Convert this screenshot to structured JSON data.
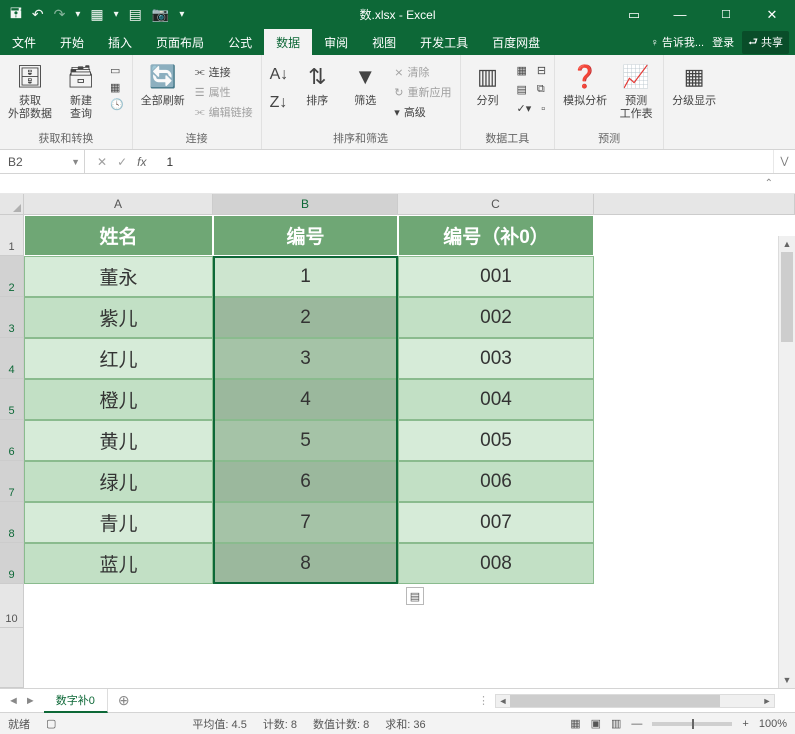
{
  "title": "数.xlsx - Excel",
  "qa": {
    "save": "💾",
    "undo": "↶",
    "redo": "↷",
    "more": "▾"
  },
  "win": {
    "ribbon": "☰",
    "min": "—",
    "max": "☐",
    "close": "✕"
  },
  "menu": {
    "tabs": [
      "文件",
      "开始",
      "插入",
      "页面布局",
      "公式",
      "数据",
      "审阅",
      "视图",
      "开发工具",
      "百度网盘"
    ],
    "active": "数据",
    "tell": "告诉我...",
    "login": "登录",
    "share": "共享"
  },
  "ribbon": {
    "g1": {
      "btn1": "获取\n外部数据",
      "label": "获取和转换"
    },
    "g1b": {
      "btn": "新建\n查询",
      "side": [
        "显示查询",
        "从表格",
        "最近使用的源"
      ]
    },
    "g2": {
      "btn": "全部刷新",
      "side": [
        "连接",
        "属性",
        "编辑链接"
      ],
      "label": "连接"
    },
    "g3": {
      "btns": [
        "排序",
        "筛选"
      ],
      "side": [
        "清除",
        "重新应用",
        "高级"
      ],
      "label": "排序和筛选"
    },
    "g4": {
      "btn": "分列",
      "label": "数据工具"
    },
    "g5": {
      "b1": "模拟分析",
      "b2": "预测\n工作表",
      "label": "预测"
    },
    "g6": {
      "btn": "分级显示",
      "label": ""
    }
  },
  "namebox": "B2",
  "formula": "1",
  "columns": [
    "A",
    "B",
    "C"
  ],
  "headers": [
    "姓名",
    "编号",
    "编号（补0）"
  ],
  "rows": [
    {
      "n": "1"
    },
    {
      "n": "2",
      "a": "董永",
      "b": "1",
      "c": "001"
    },
    {
      "n": "3",
      "a": "紫儿",
      "b": "2",
      "c": "002"
    },
    {
      "n": "4",
      "a": "红儿",
      "b": "3",
      "c": "003"
    },
    {
      "n": "5",
      "a": "橙儿",
      "b": "4",
      "c": "004"
    },
    {
      "n": "6",
      "a": "黄儿",
      "b": "5",
      "c": "005"
    },
    {
      "n": "7",
      "a": "绿儿",
      "b": "6",
      "c": "006"
    },
    {
      "n": "8",
      "a": "青儿",
      "b": "7",
      "c": "007"
    },
    {
      "n": "9",
      "a": "蓝儿",
      "b": "8",
      "c": "008"
    },
    {
      "n": "10"
    }
  ],
  "sheet_tab": "数字补0",
  "status": {
    "ready": "就绪",
    "avg": "平均值: 4.5",
    "count": "计数: 8",
    "numcount": "数值计数: 8",
    "sum": "求和: 36",
    "zoom": "100%"
  }
}
